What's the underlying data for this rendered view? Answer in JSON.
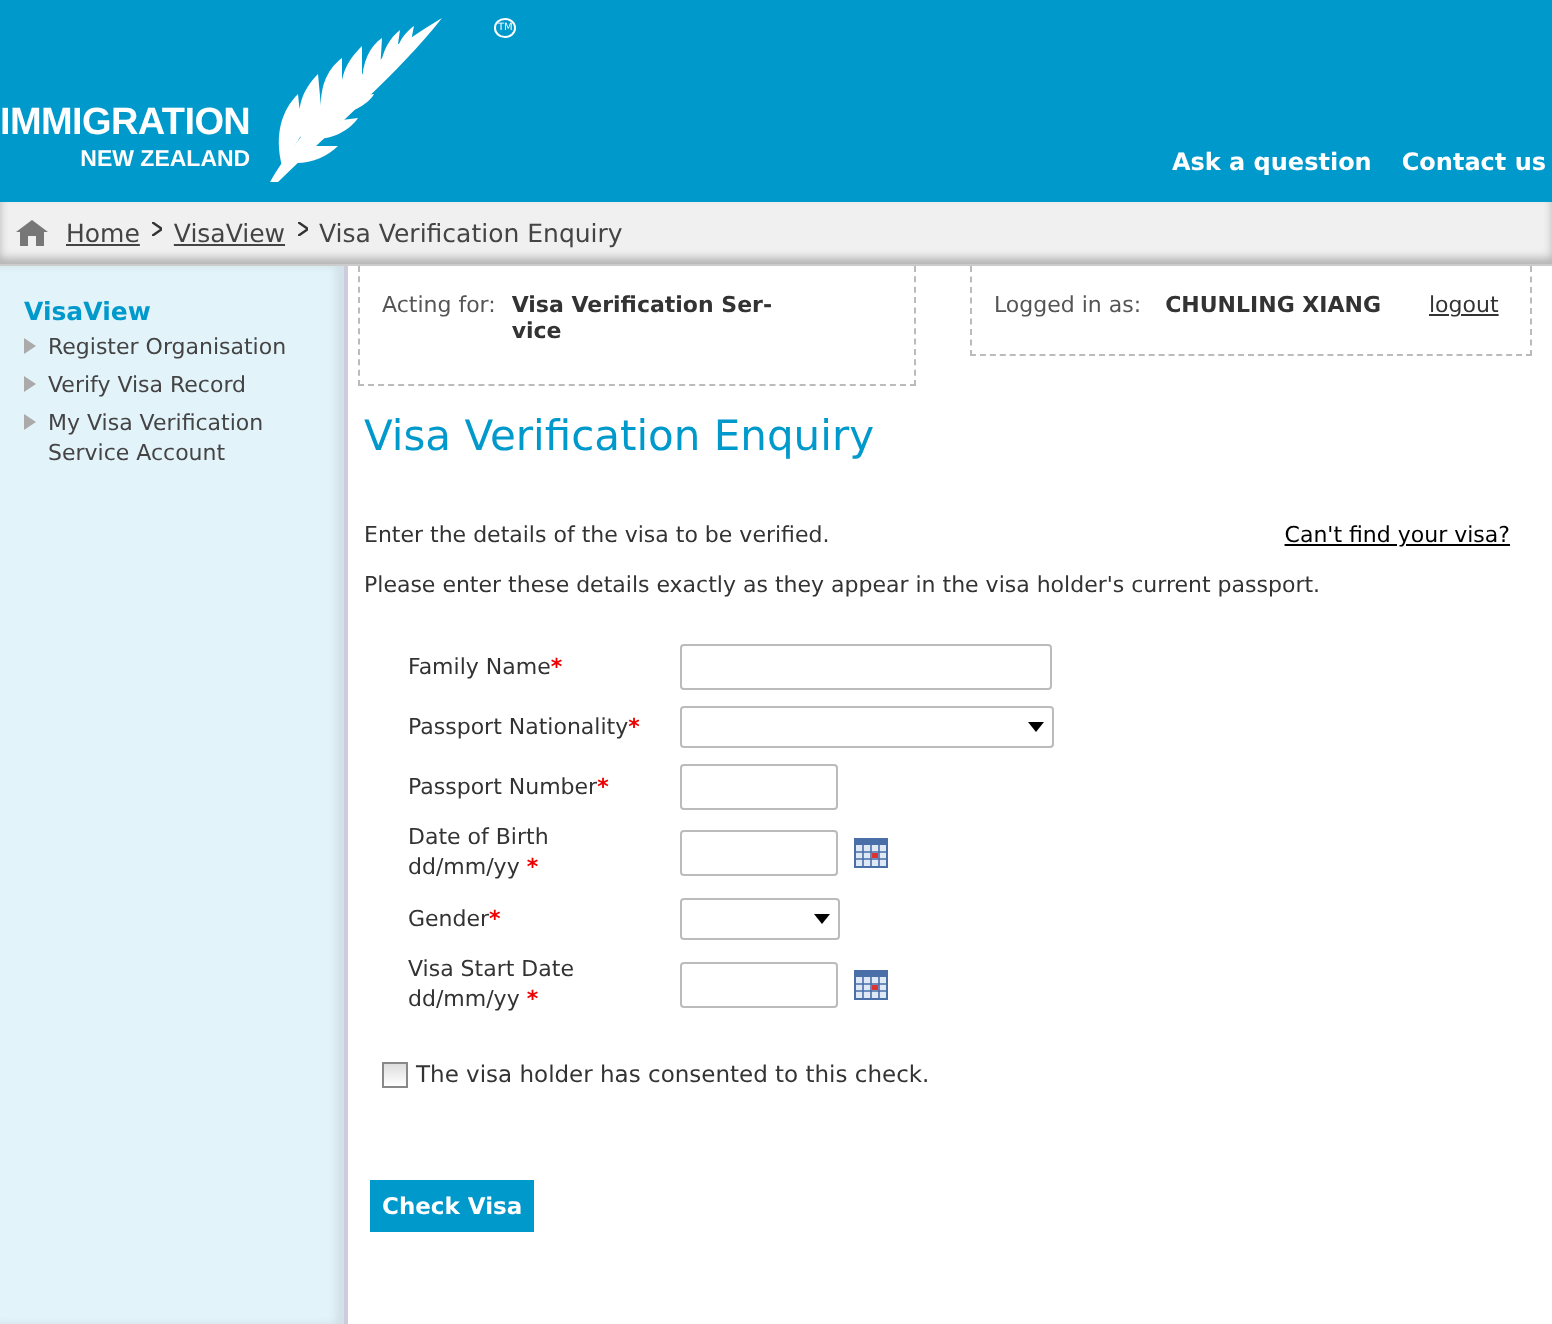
{
  "header": {
    "logo": {
      "line1": "IMMIGRATION",
      "line2": "NEW ZEALAND",
      "trademark": "TM"
    },
    "links": [
      "Ask a question",
      "Contact us"
    ]
  },
  "breadcrumb": [
    {
      "label": "Home",
      "link": true
    },
    {
      "label": "VisaView",
      "link": true
    },
    {
      "label": "Visa Verification Enquiry",
      "link": false
    }
  ],
  "sidebar": {
    "title": "VisaView",
    "items": [
      "Register Organisation",
      "Verify Visa Record",
      "My Visa Verification Service Account"
    ]
  },
  "acting_for": {
    "label": "Acting for:",
    "value": "Visa Verification Ser-vice"
  },
  "logged_in": {
    "label": "Logged in as:",
    "user": "CHUNLING XIANG",
    "logout": "logout"
  },
  "title": "Visa Verification Enquiry",
  "intro": "Enter the details of the visa to be verified.",
  "help_link": "Can't find your visa?",
  "instruction": "Please enter these details exactly as they appear in the visa holder's current passport.",
  "fields": [
    {
      "kind": "text",
      "label": "Family Name",
      "wide": true
    },
    {
      "kind": "select",
      "label": "Passport Nationality",
      "wide": true
    },
    {
      "kind": "text",
      "label": "Passport Number",
      "wide": false
    },
    {
      "kind": "date",
      "label": "Date of Birth",
      "hint": "dd/mm/yy",
      "wide": false
    },
    {
      "kind": "select",
      "label": "Gender",
      "wide": false
    },
    {
      "kind": "date",
      "label": "Visa Start Date",
      "hint": "dd/mm/yy",
      "wide": false
    }
  ],
  "required_mark": "*",
  "consent": {
    "label": "The visa holder has consented to this check.",
    "checked": false
  },
  "submit": "Check Visa"
}
